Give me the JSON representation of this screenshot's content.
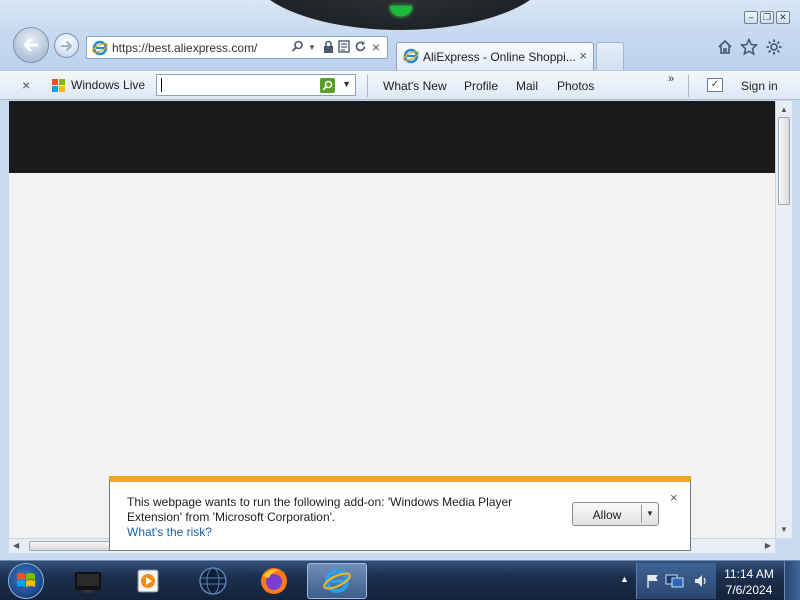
{
  "browser": {
    "address_url": "https://best.aliexpress.com/",
    "tab_title": "AliExpress - Online Shoppi...",
    "window_buttons": [
      "minimize",
      "restore",
      "close"
    ]
  },
  "command_bar": {
    "brand": "Windows Live",
    "search_value": "",
    "links": [
      "What's New",
      "Profile",
      "Mail",
      "Photos"
    ],
    "more": "»",
    "sign_in": "Sign in"
  },
  "notification": {
    "message": "This webpage wants to run the following add-on: 'Windows Media Player Extension' from 'Microsoft Corporation'.",
    "risk_link": "What's the risk?",
    "allow_label": "Allow",
    "accent_color": "#f0a81b"
  },
  "taskbar": {
    "items": [
      "media-center-icon",
      "media-player-icon",
      "globe-icon",
      "firefox-icon",
      "internet-explorer-icon"
    ],
    "active_item": "internet-explorer-icon",
    "clock_time": "11:14 AM",
    "clock_date": "7/6/2024"
  },
  "icons": {
    "close": "×",
    "dropdown": "▼",
    "scroll_up": "▲",
    "scroll_down": "▼",
    "scroll_left": "◀",
    "scroll_right": "▶",
    "tray_arrow": "▲",
    "check": "✓"
  }
}
